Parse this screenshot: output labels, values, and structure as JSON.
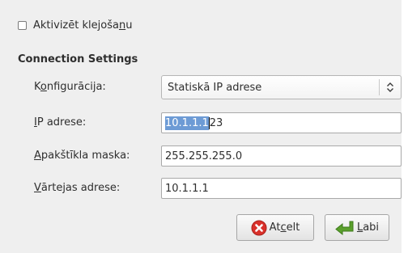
{
  "checkbox": {
    "label_before": "Aktivizēt klejoša",
    "label_mnemonic": "n",
    "label_after": "u",
    "checked": false
  },
  "section_title": "Connection Settings",
  "fields": {
    "konfiguracija": {
      "label_before": "K",
      "label_mnemonic": "o",
      "label_after": "nfigurācija:",
      "value": "Statiskā IP adrese"
    },
    "ip": {
      "label_mnemonic": "I",
      "label_after": "P adrese:",
      "value_selected": "10.1.1.1",
      "value_rest": "23"
    },
    "mask": {
      "label_mnemonic": "A",
      "label_after": "pakštīkla maska:",
      "value": "255.255.255.0"
    },
    "gateway": {
      "label_mnemonic": "V",
      "label_after": "ārtejas adrese:",
      "value": "10.1.1.1"
    }
  },
  "buttons": {
    "cancel": {
      "label_before": "At",
      "label_mnemonic": "c",
      "label_after": "elt",
      "icon": "cancel-icon",
      "icon_color": "#d9302a"
    },
    "ok": {
      "label_mnemonic": "L",
      "label_after": "abi",
      "icon": "enter-arrow-icon",
      "icon_color": "#5aa02c"
    }
  },
  "colors": {
    "selection": "#6d9bd5",
    "dialog_bg": "#efefef"
  }
}
